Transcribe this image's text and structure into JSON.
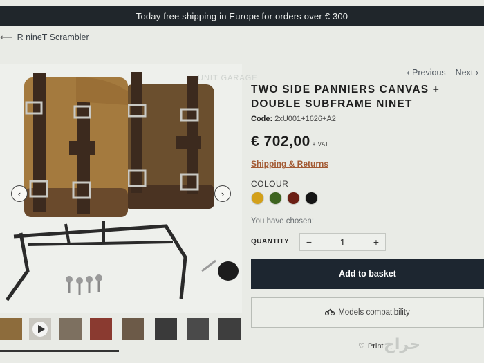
{
  "promo_text": "Today free shipping in Europe for orders over € 300",
  "breadcrumb": {
    "back_label": "R nineT Scrambler"
  },
  "pager": {
    "previous_label": "Previous",
    "next_label": "Next"
  },
  "watermark_text": "UNIT GARAGE",
  "product": {
    "title": "TWO SIDE PANNIERS CANVAS + DOUBLE SUBFRAME NINET",
    "code_label": "Code:",
    "code_value": "2xU001+1626+A2",
    "price": "€ 702,00",
    "vat_label": "+ VAT",
    "shipping_link": "Shipping & Returns",
    "colour_label": "COLOUR",
    "colours": [
      "#d3a01a",
      "#3e6420",
      "#6b1f14",
      "#151515"
    ],
    "chosen_label": "You have chosen:",
    "quantity_label": "QUANTITY",
    "quantity_value": "1",
    "minus": "−",
    "plus": "+",
    "add_to_basket": "Add to basket",
    "models_compatibility": "Models compatibility",
    "print_label": "Print"
  },
  "gallery": {
    "prev_arrow": "‹",
    "next_arrow": "›"
  },
  "thumbnails_count": 8,
  "overlay_logo": "حراج"
}
